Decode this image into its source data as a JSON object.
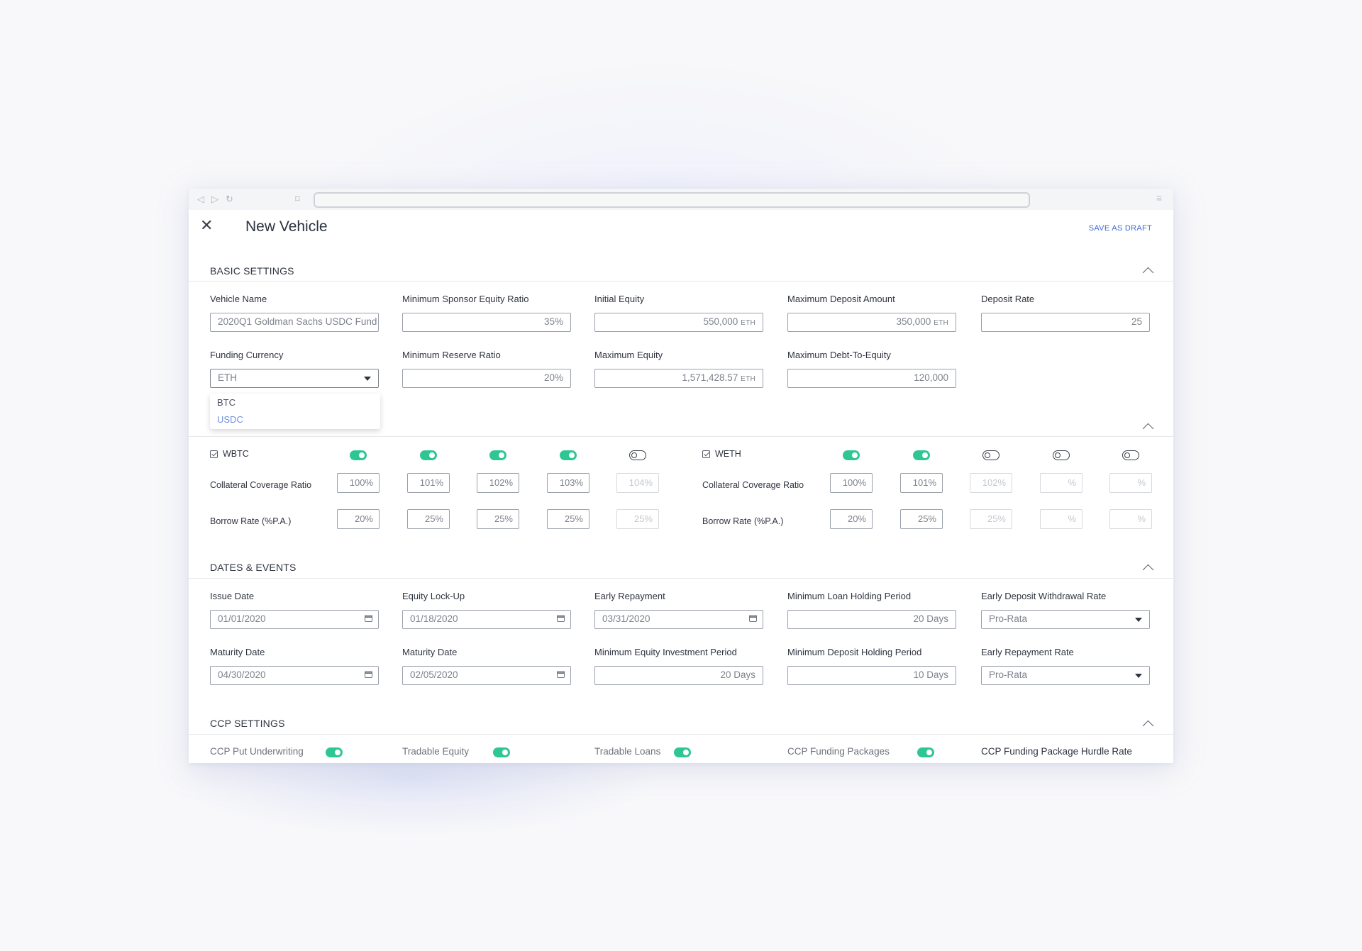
{
  "header": {
    "title": "New Vehicle",
    "save_draft": "SAVE AS DRAFT"
  },
  "sections": {
    "basic": "BASIC SETTINGS",
    "dates": "DATES & EVENTS",
    "ccp": "CCP SETTINGS"
  },
  "basic": {
    "vehicle_name": {
      "label": "Vehicle Name",
      "value": "2020Q1 Goldman Sachs USDC Fund"
    },
    "min_sponsor_equity": {
      "label": "Minimum Sponsor Equity Ratio",
      "value": "35%"
    },
    "initial_equity": {
      "label": "Initial Equity",
      "value": "550,000",
      "unit": "ETH"
    },
    "max_deposit": {
      "label": "Maximum Deposit Amount",
      "value": "350,000",
      "unit": "ETH"
    },
    "deposit_rate": {
      "label": "Deposit Rate",
      "value": "25"
    },
    "funding_currency": {
      "label": "Funding Currency",
      "value": "ETH",
      "options": [
        "BTC",
        "USDC"
      ]
    },
    "min_reserve": {
      "label": "Minimum Reserve Ratio",
      "value": "20%"
    },
    "max_equity": {
      "label": "Maximum Equity",
      "value": "1,571,428.57",
      "unit": "ETH"
    },
    "max_debt_equity": {
      "label": "Maximum Debt-To-Equity",
      "value": "120,000"
    }
  },
  "collateral": {
    "row_label_ccr": "Collateral Coverage Ratio",
    "row_label_borrow": "Borrow Rate (%P.A.)",
    "wbtc": {
      "name": "WBTC",
      "ccr": [
        "100%",
        "101%",
        "102%",
        "103%",
        "104%"
      ],
      "borrow": [
        "20%",
        "25%",
        "25%",
        "25%",
        "25%"
      ]
    },
    "weth": {
      "name": "WETH",
      "ccr": [
        "100%",
        "101%",
        "102%",
        "%",
        "%"
      ],
      "borrow": [
        "20%",
        "25%",
        "25%",
        "%",
        "%"
      ]
    }
  },
  "dates": {
    "issue_date": {
      "label": "Issue Date",
      "value": "01/01/2020"
    },
    "equity_lockup": {
      "label": "Equity Lock-Up",
      "value": "01/18/2020"
    },
    "early_repayment": {
      "label": "Early Repayment",
      "value": "03/31/2020"
    },
    "min_loan_holding": {
      "label": "Minimum Loan Holding Period",
      "value": "20 Days"
    },
    "early_deposit_withdrawal": {
      "label": "Early Deposit Withdrawal Rate",
      "value": "Pro-Rata"
    },
    "maturity_date_1": {
      "label": "Maturity Date",
      "value": "04/30/2020"
    },
    "maturity_date_2": {
      "label": "Maturity Date",
      "value": "02/05/2020"
    },
    "min_equity_investment": {
      "label": "Minimum Equity Investment Period",
      "value": "20 Days"
    },
    "min_deposit_holding": {
      "label": "Minimum Deposit  Holding Period",
      "value": "10 Days"
    },
    "early_repayment_rate": {
      "label": "Early Repayment Rate",
      "value": "Pro-Rata"
    }
  },
  "ccp": {
    "put_underwriting": "CCP Put Underwriting",
    "tradable_equity": "Tradable Equity",
    "tradable_loans": "Tradable Loans",
    "funding_packages": "CCP Funding Packages",
    "hurdle_rate": "CCP Funding Package Hurdle Rate"
  },
  "colors": {
    "accent": "#3f6ad8",
    "toggle_on": "#2ec793",
    "usdc_option": "#6f8fe0"
  }
}
